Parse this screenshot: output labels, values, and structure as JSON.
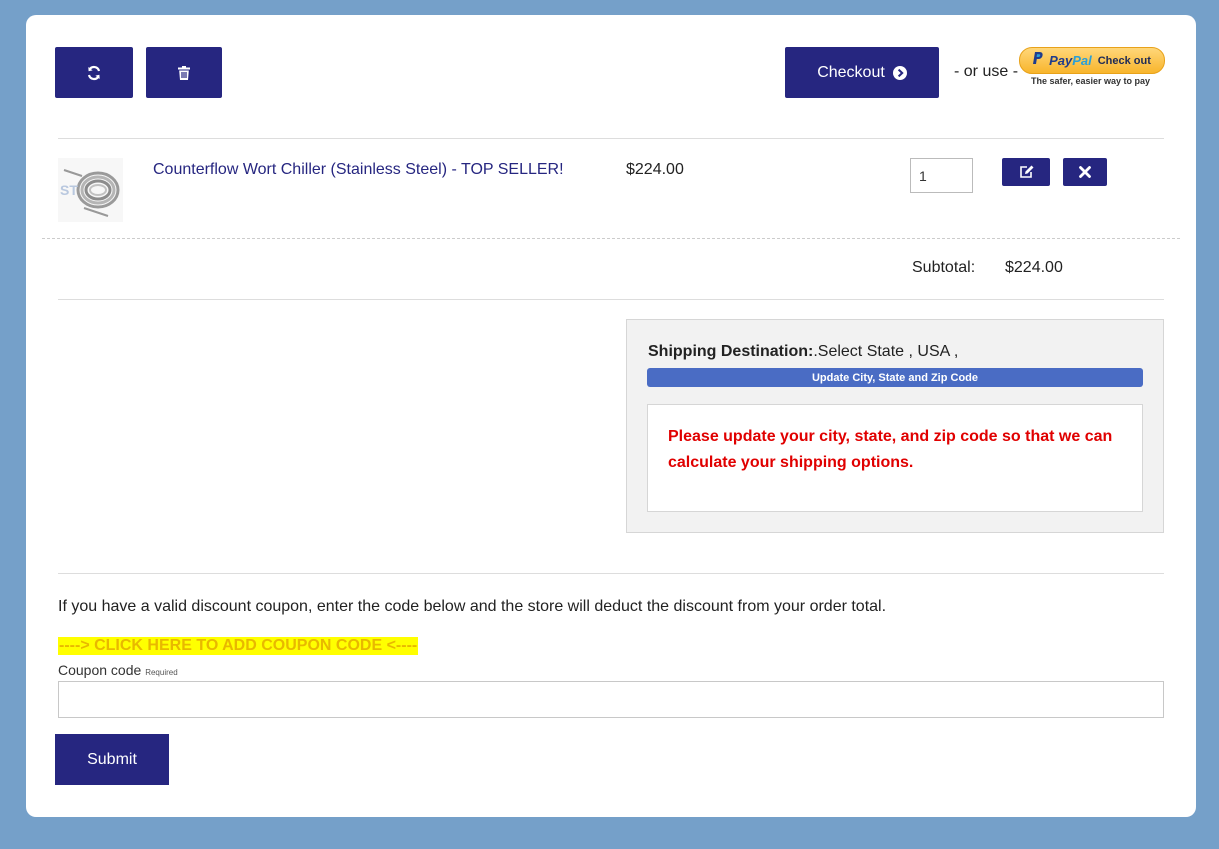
{
  "toolbar": {
    "refresh_icon": "refresh-icon",
    "delete_icon": "trash-icon",
    "checkout_label": "Checkout",
    "or_use": "- or use -",
    "paypal": {
      "brand_a": "Pay",
      "brand_b": "Pal",
      "check_out": "Check out",
      "tagline": "The safer, easier way to pay"
    }
  },
  "cart": {
    "items": [
      {
        "name": "Counterflow Wort Chiller (Stainless Steel) - TOP SELLER!",
        "price": "$224.00",
        "quantity": "1"
      }
    ],
    "subtotal_label": "Subtotal:",
    "subtotal_value": "$224.00"
  },
  "shipping": {
    "title": "Shipping Destination:",
    "destination": ".Select State , USA ,",
    "update_label": "Update City, State and Zip Code",
    "message": "Please update your city, state, and zip code so that we can calculate your shipping options."
  },
  "coupon": {
    "intro": "If you have a valid discount coupon, enter the code below and the store will deduct the discount from your order total.",
    "link": "----> CLICK HERE TO ADD COUPON CODE <----",
    "label": "Coupon code",
    "required": "Required",
    "value": "",
    "submit_label": "Submit"
  },
  "colors": {
    "page_bg": "#75a0c9",
    "button": "#262680",
    "update_bar": "#4a6cc4",
    "warning": "#e00000",
    "highlight": "#ffff00"
  }
}
